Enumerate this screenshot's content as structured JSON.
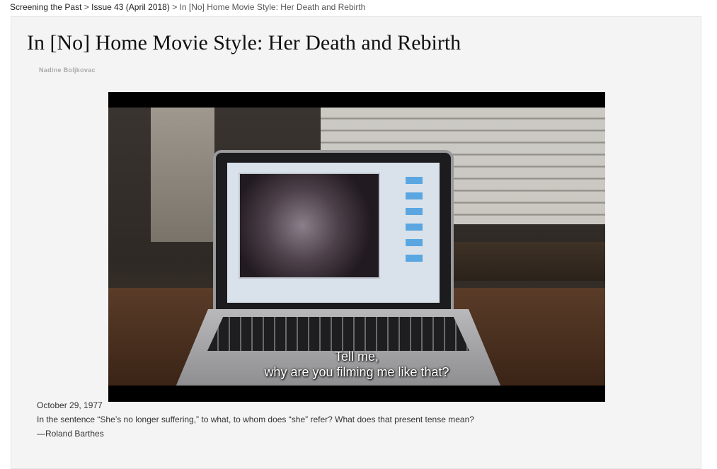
{
  "breadcrumb": {
    "items": [
      "Screening the Past",
      "Issue 43 (April 2018)"
    ],
    "separator": ">",
    "current": "In [No] Home Movie Style: Her Death and Rebirth"
  },
  "article": {
    "title": "In [No] Home Movie Style: Her Death and Rebirth",
    "author": "Nadine Boljkovac"
  },
  "video": {
    "subtitle_line1": "Tell me,",
    "subtitle_line2": "why are you filming me like that?"
  },
  "epigraph": {
    "date": "October 29, 1977",
    "quote": "In the sentence “She’s no longer suffering,” to what, to whom does “she” refer? What does that present tense mean?",
    "attribution": "—Roland Barthes"
  }
}
